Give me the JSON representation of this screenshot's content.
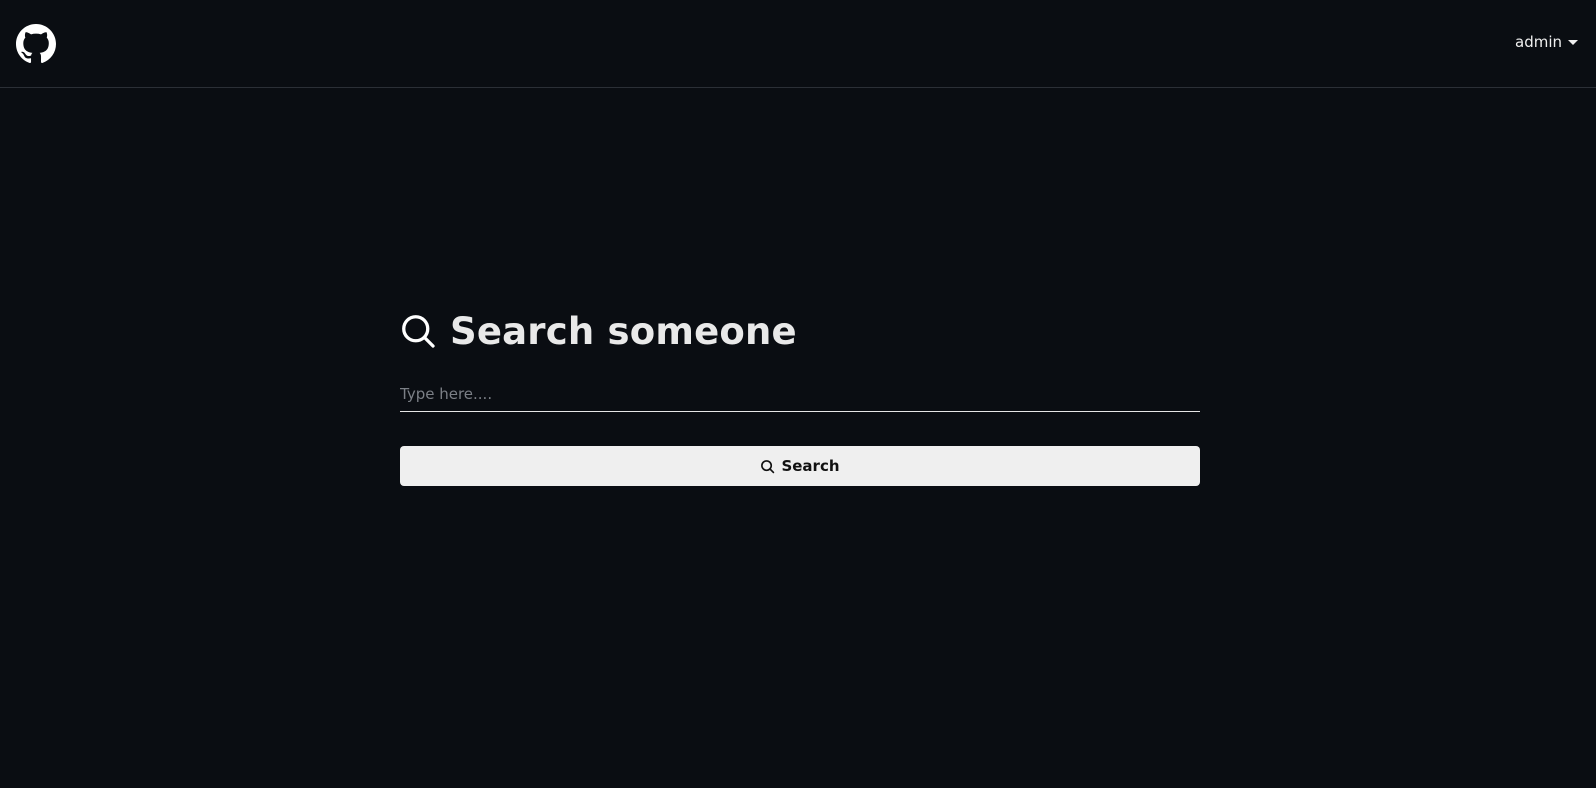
{
  "header": {
    "logo_icon": "github-icon",
    "user_label": "admin",
    "user_caret_icon": "caret-down-icon"
  },
  "search": {
    "heading_icon": "search-icon",
    "heading": "Search someone",
    "placeholder": "Type here....",
    "value": "",
    "button_icon": "search-icon",
    "button_label": "Search"
  },
  "colors": {
    "background": "#0a0d12",
    "navbar_border": "#2b2f36",
    "text": "#e9e9e9",
    "button_bg": "#efefef",
    "button_text": "#111111"
  }
}
